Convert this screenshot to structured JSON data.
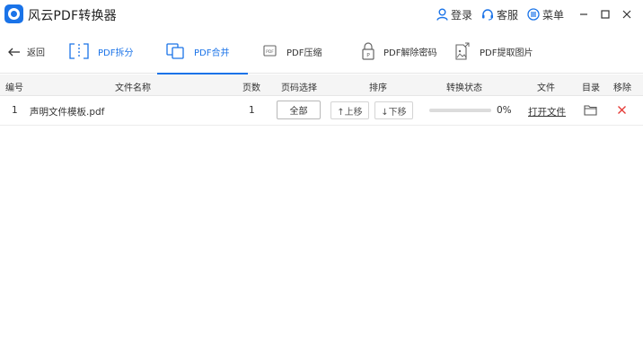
{
  "app": {
    "title": "风云PDF转换器",
    "brand_color": "#1a73e8"
  },
  "titlebar": {
    "login_label": "登录",
    "service_label": "客服",
    "menu_label": "菜单",
    "icons": [
      "user-icon",
      "headset-icon",
      "menu-icon",
      "minimize-icon",
      "maximize-icon",
      "close-icon"
    ]
  },
  "toolbar": {
    "back_label": "返回",
    "tabs": [
      {
        "label": "PDF拆分",
        "icon": "split-icon",
        "active": false
      },
      {
        "label": "PDF合并",
        "icon": "merge-icon",
        "active": true
      },
      {
        "label": "PDF压缩",
        "icon": "compress-icon",
        "active": false
      },
      {
        "label": "PDF解除密码",
        "icon": "unlock-icon",
        "active": false
      },
      {
        "label": "PDF提取图片",
        "icon": "extract-image-icon",
        "active": false
      }
    ]
  },
  "table": {
    "headers": {
      "index": "编号",
      "filename": "文件名称",
      "pages": "页数",
      "page_select": "页码选择",
      "order": "排序",
      "status": "转换状态",
      "file": "文件",
      "directory": "目录",
      "remove": "移除"
    },
    "rows": [
      {
        "index": "1",
        "filename": "声明文件模板.pdf",
        "pages": "1",
        "page_select_label": "全部",
        "move_up_label": "↑上移",
        "move_down_label": "↓下移",
        "progress": 0,
        "progress_text": "0%",
        "open_label": "打开文件"
      }
    ]
  }
}
